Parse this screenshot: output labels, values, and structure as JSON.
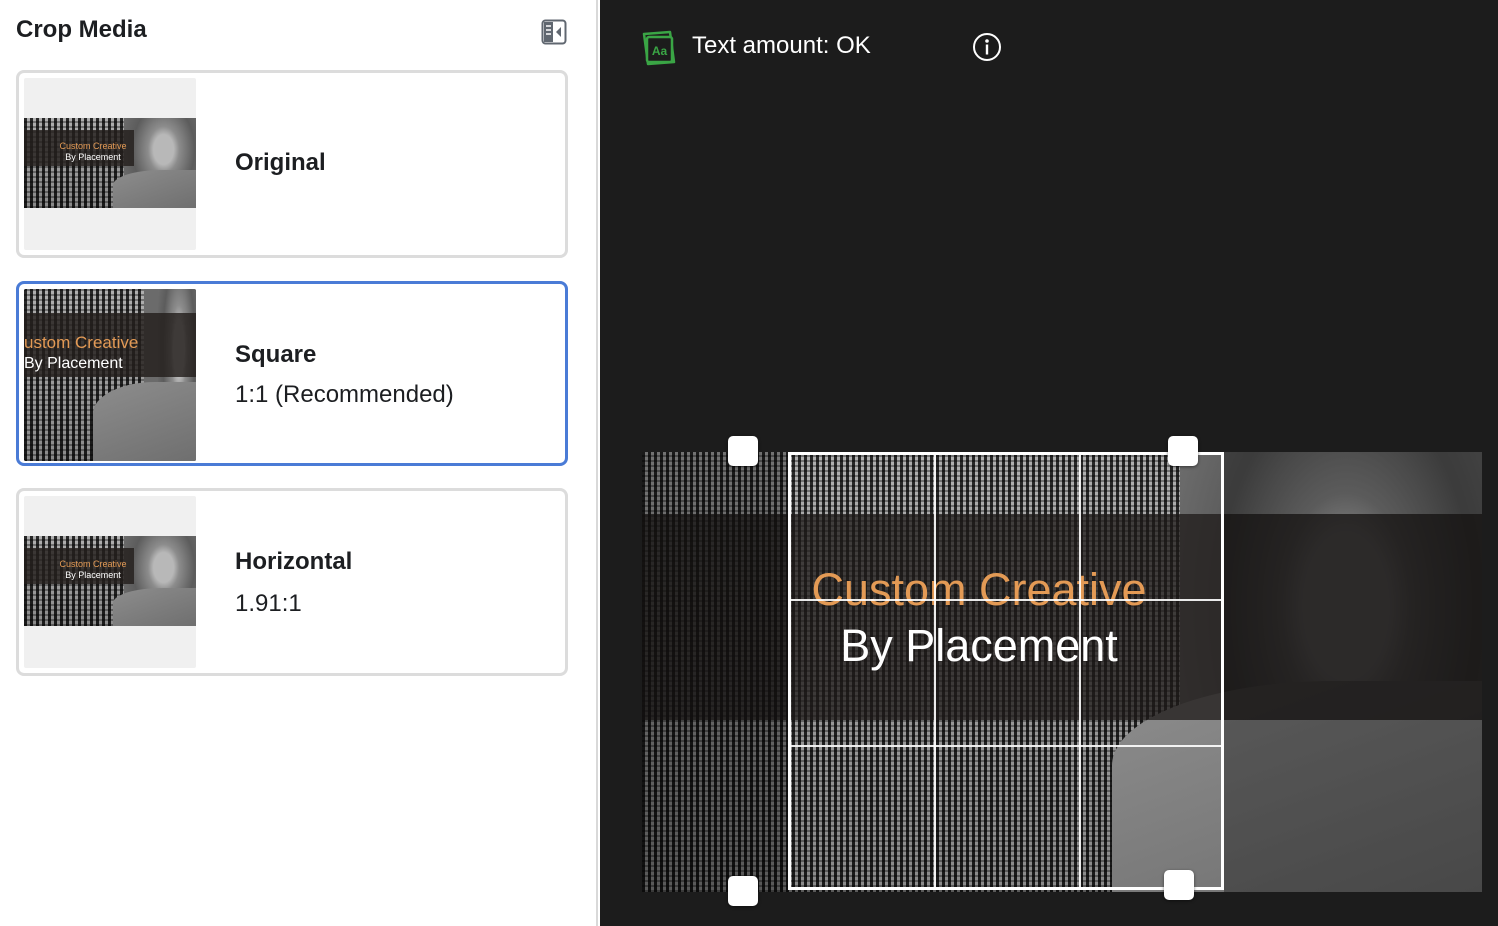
{
  "panel": {
    "title": "Crop Media"
  },
  "options": [
    {
      "label": "Original",
      "sub": ""
    },
    {
      "label": "Square",
      "sub": "1:1 (Recommended)"
    },
    {
      "label": "Horizontal",
      "sub": "1.91:1"
    }
  ],
  "thumb_text": {
    "line1": "Custom Creative",
    "line2": "By Placement",
    "square_line1": "ustom Creative",
    "square_line2": "By Placement"
  },
  "editor": {
    "text_amount": "Text amount: OK",
    "overlay_line1": "Custom Creative",
    "overlay_line2": "By Placement",
    "accent_color": "#e39a55",
    "ok_color": "#3aa545",
    "selected_color": "#4a7bd6"
  },
  "icons": {
    "collapse": "panel-collapse-icon",
    "text_amount": "text-overlay-icon",
    "info": "info-icon"
  }
}
